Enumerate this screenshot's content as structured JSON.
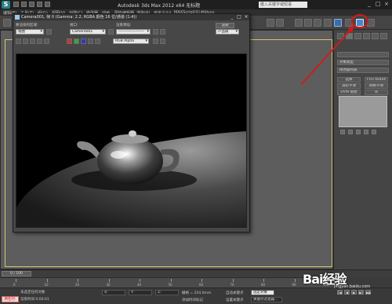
{
  "window": {
    "title": "Autodesk 3ds Max  2012 x64    无标题",
    "search_placeholder": "键入关键字或短语",
    "minimize": "_",
    "maximize": "□",
    "close": "×"
  },
  "menubar": {
    "items": [
      "编辑(E)",
      "工具(T)",
      "组(G)",
      "视图(V)",
      "创建(C)",
      "修改器",
      "动画",
      "图形编辑器",
      "渲染(R)",
      "自定义(U)",
      "MAXScript(X)",
      "帮助(H)"
    ]
  },
  "render_frame": {
    "title": "Camera001, 帧 0 (Gamma: 2.2, RGBA 颜色 16 位/通道 (1:4))",
    "area_label": "要渲染的区域:",
    "area_value": "视图",
    "viewport_label": "视口:",
    "viewport_value": "Camera001",
    "preset_label": "渲染预设:",
    "preset_value": "--------------------",
    "render_button": "渲染",
    "mode_value": "产品级",
    "channel_value": "RGB Alpha"
  },
  "command_panel": {
    "object_type_header": "对象类型",
    "modifier_list": "修改器列表",
    "buttons": [
      "选择",
      "FFD 4x4x4",
      "涡轮平滑",
      "网格平滑",
      "UVW 贴图",
      "壳",
      "UVW 展开",
      "Edit Poly"
    ]
  },
  "timeline": {
    "slider": "0 / 100",
    "ticks": [
      "0",
      "10",
      "20",
      "30",
      "40",
      "50",
      "60",
      "70",
      "80",
      "90",
      "100"
    ]
  },
  "status": {
    "selection": "未选定任何对象",
    "prompt": "渲染时间 0:00:01",
    "badge": "所在行:",
    "x_value": "X:",
    "y_value": "Y:",
    "z_value": "Z:",
    "grid": "栅格 = 254.0mm",
    "auto_key": "自动关键点",
    "selected": "选定对象",
    "set_key": "设置关键点",
    "key_filter": "关键点过滤器...",
    "add_time_tag": "添加时间标记"
  },
  "watermark": {
    "logo": "Bai经验",
    "site": "jingyan.baidu.com"
  },
  "colors": {
    "accent_frame": "#d6c36a",
    "annotation_arrow": "#d11a1a",
    "highlight_button": "#4a88c8"
  }
}
